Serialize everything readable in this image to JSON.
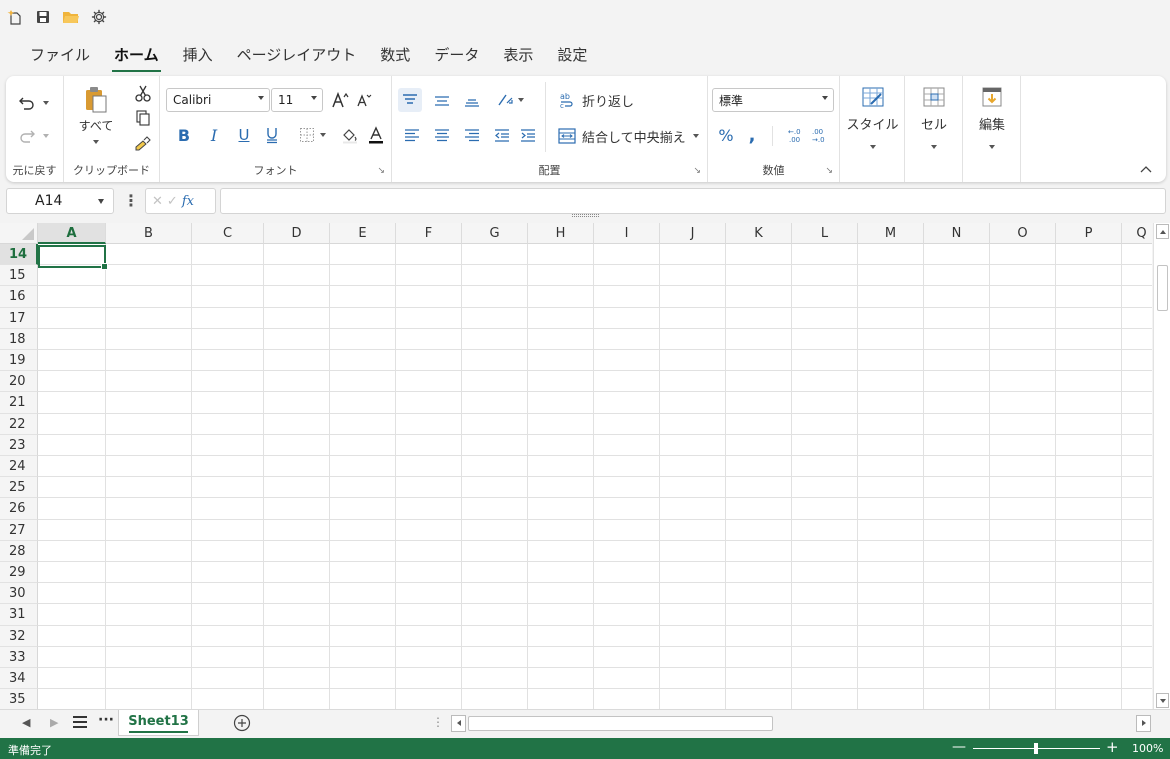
{
  "quick_access": [
    "new-file-icon",
    "save-icon",
    "open-folder-icon",
    "settings-icon"
  ],
  "tabs": [
    {
      "label": "ファイル",
      "active": false
    },
    {
      "label": "ホーム",
      "active": true
    },
    {
      "label": "挿入",
      "active": false
    },
    {
      "label": "ページレイアウト",
      "active": false
    },
    {
      "label": "数式",
      "active": false
    },
    {
      "label": "データ",
      "active": false
    },
    {
      "label": "表示",
      "active": false
    },
    {
      "label": "設定",
      "active": false
    }
  ],
  "ribbon": {
    "undo_group": {
      "label": "元に戻す"
    },
    "clipboard": {
      "label": "クリップボード",
      "paste_label": "すべて"
    },
    "font": {
      "label": "フォント",
      "font_name": "Calibri",
      "font_size": "11"
    },
    "alignment": {
      "label": "配置",
      "wrap_label": "折り返し",
      "merge_label": "結合して中央揃え"
    },
    "number": {
      "label": "数値",
      "format": "標準"
    },
    "style": {
      "label": "スタイル"
    },
    "cell": {
      "label": "セル"
    },
    "edit": {
      "label": "編集"
    }
  },
  "formula_bar": {
    "name_box": "A14",
    "formula": ""
  },
  "columns": [
    "A",
    "B",
    "C",
    "D",
    "E",
    "F",
    "G",
    "H",
    "I",
    "J",
    "K",
    "L",
    "M",
    "N",
    "O",
    "P",
    "Q"
  ],
  "selected_column": "A",
  "rows": [
    "14",
    "15",
    "16",
    "17",
    "18",
    "19",
    "20",
    "21",
    "22",
    "23",
    "24",
    "25",
    "26",
    "27",
    "28",
    "29",
    "30",
    "31",
    "32",
    "33",
    "34",
    "35"
  ],
  "selected_row": "14",
  "sheet": {
    "active_tab": "Sheet13"
  },
  "status": {
    "text": "準備完了",
    "zoom": "100%"
  },
  "colors": {
    "accent": "#217346",
    "ribbon_icon_blue": "#2b6cb0"
  }
}
